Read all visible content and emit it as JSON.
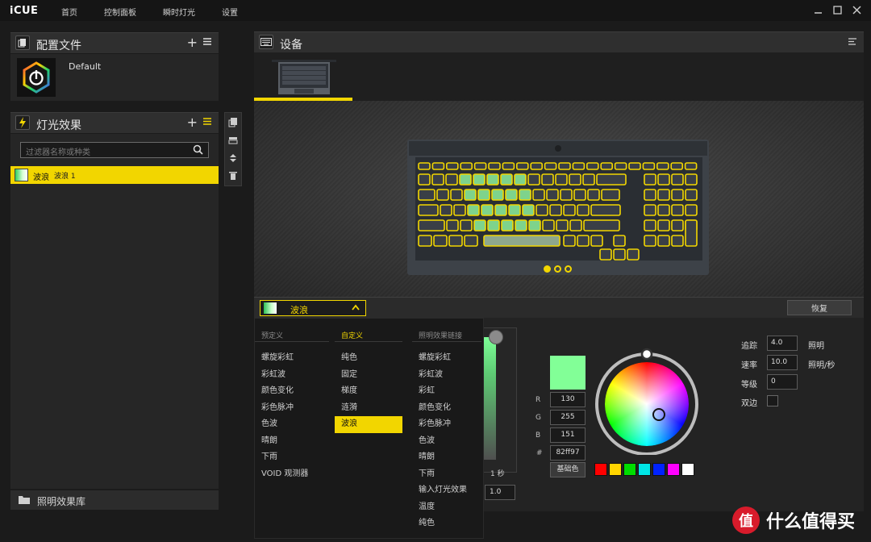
{
  "app": {
    "logo": "iCUE"
  },
  "nav": [
    "首页",
    "控制面板",
    "瞬时灯光",
    "设置"
  ],
  "profiles": {
    "title": "配置文件",
    "items": [
      {
        "name": "Default"
      }
    ]
  },
  "lighting": {
    "title": "灯光效果",
    "search_placeholder": "过滤器名称或种类",
    "effects": [
      {
        "name": "波浪",
        "detail": "波浪 1"
      }
    ]
  },
  "library": {
    "title": "照明效果库"
  },
  "device": {
    "title": "设备"
  },
  "keyboard": {
    "pages": 3,
    "active_page": 0,
    "accent": "#f2d600"
  },
  "editor": {
    "effect_name": "波浪",
    "restore_label": "恢复",
    "dropdown": {
      "columns": [
        {
          "header": "预定义",
          "items": [
            "螺旋彩虹",
            "彩虹波",
            "颜色变化",
            "彩色脉冲",
            "色波",
            "晴朗",
            "下雨",
            "VOID 观测器"
          ]
        },
        {
          "header": "自定义",
          "items": [
            "纯色",
            "固定",
            "梯度",
            "涟漪",
            "波浪"
          ],
          "selected_item": 4
        },
        {
          "header": "照明效果链接",
          "items": [
            "螺旋彩虹",
            "彩虹波",
            "彩虹",
            "颜色变化",
            "彩色脉冲",
            "色波",
            "晴朗",
            "下雨",
            "输入灯光效果",
            "温度",
            "纯色"
          ]
        }
      ],
      "selected_column": 1
    },
    "time_label": "1 秒",
    "time_value": "1.0",
    "color": {
      "hex": "82ff97",
      "r": "130",
      "g": "255",
      "b": "151",
      "labels": {
        "r": "R",
        "g": "G",
        "b": "B",
        "hex": "#"
      },
      "base_label": "基础色",
      "palette": [
        "#ff0000",
        "#ffd500",
        "#00dd00",
        "#00e5e5",
        "#0022ff",
        "#ff00ff",
        "#ffffff"
      ]
    },
    "params": {
      "trail_label": "追踪",
      "trail_value": "4.0",
      "trail_unit": "照明",
      "speed_label": "速率",
      "speed_value": "10.0",
      "speed_unit": "照明/秒",
      "level_label": "等级",
      "level_value": "0",
      "bidir_label": "双边"
    }
  },
  "watermark": {
    "text": "什么值得买",
    "logo_char": "值"
  }
}
